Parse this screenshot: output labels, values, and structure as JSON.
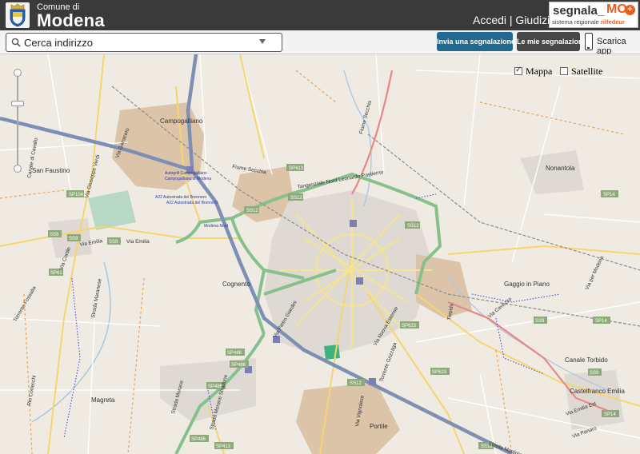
{
  "header": {
    "city_small": "Comune di",
    "city_big": "Modena",
    "login_link": "Accedi | Giudizio",
    "brand": {
      "name": "segnala_",
      "name_suffix": "MO",
      "plus": "+",
      "subtitle": "sistema regionale ",
      "subtitle_accent": "rilfedeur"
    }
  },
  "toolbar": {
    "search_value": "Cerca indirizzo",
    "report_button": "Invia una segnalazione",
    "my_reports_button": "Le mie segnalazioni",
    "download_app": "Scarica app"
  },
  "map": {
    "layers": [
      {
        "label": "Mappa",
        "checked": true
      },
      {
        "label": "Satellite",
        "checked": false
      }
    ],
    "places": {
      "campogalliano": "Campogalliano",
      "san_faustino": "San Faustino",
      "nonantola": "Nonantola",
      "cognento": "Cognento",
      "gaggio": "Gaggio in Piano",
      "magreta": "Magreta",
      "canale_torbido": "Canale Torbido",
      "castelfranco": "Castelfranco Emilia",
      "portile": "Portile"
    },
    "roads": {
      "fiume_secchia": "Fiume Secchia",
      "fiume_secchia_2": "Fiume Secchia",
      "tangenziale": "Tangenziale Nord Leonardo Pastierno",
      "via_emilia": "Via Emilia",
      "via_emilia_2": "Via Emilia",
      "via_giardini": "Via Pietro Giardini",
      "via_nuova_estense": "Via Nuova Estense",
      "via_ganaceto": "Via Ganaceto",
      "via_giuseppe_verdi": "Via Giuseppe Verdi",
      "via_cortile": "Via Cortile",
      "via_pompa": "Strada Morane",
      "via_vignolese": "Via Vignolese",
      "via_per_modena": "Via per Modena",
      "canale_di_carpi": "Canale di Cavallo",
      "via_formigine": "Strada Maranese",
      "via_emilia_est": "Via Emilia Est",
      "torrente_tiepido": "Tiepido",
      "torrente_fossalta": "Torrente Fossalta",
      "via_cavezzo": "Via Cavezzo",
      "rio_corlecchi": "Rio Corlecchi",
      "strada_martiniana": "Strada Martiniana",
      "torrente_grizzaga": "Torrente Grizzaga",
      "via_pico": "Via Panaro",
      "strada_formiginese": "Strada Morane Stradone"
    },
    "markers": {
      "a22": "A22 Autostrada del Brennero",
      "a22b": "A22 Autostrada del Brennero",
      "autogrill": "Autogrill Campogalliano",
      "autogrill2": "Campogalliano di Modena",
      "modena_nord": "Modena Nord"
    },
    "shields": [
      "SP413",
      "SP104",
      "SS12",
      "SS12",
      "SS9",
      "SS9",
      "SS9",
      "SP61",
      "SP486",
      "SP486",
      "SP486",
      "SP486",
      "SS12",
      "SP623",
      "SP623",
      "SP14",
      "SP14",
      "SS9",
      "SS9",
      "SP14",
      "SS12",
      "SP413",
      "SS12"
    ],
    "colors": {
      "background": "#efebe2",
      "urban": "#e0d9d0",
      "industrial": "#dfc1a3",
      "motorway": "#7d8fb4",
      "trunk": "#86c08c",
      "primary": "#e8868a",
      "secondary": "#fbe179",
      "water": "#a7c8e5"
    }
  }
}
